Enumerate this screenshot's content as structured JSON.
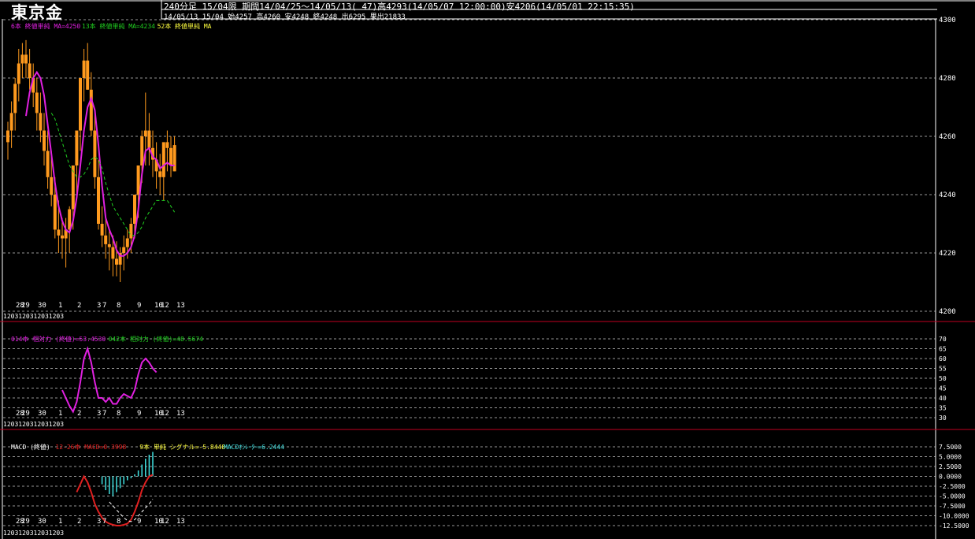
{
  "header": {
    "title": "東京金",
    "line1": "240分足 15/04限  期間14/04/25～14/05/13( 47)高4293(14/05/07 12:00:00)安4206(14/05/01 22:15:35)",
    "line2": "14/05/13 15/04 始4257 高4260 安4248 終4248 出6295 果出21833"
  },
  "colors": {
    "candle": "#ff9a1e",
    "ma6": "#e020e0",
    "ma13": "#20d020",
    "ma52": "#ffff40",
    "rsi14": "#e020e0",
    "macd": "#e02020",
    "signal": "#ffffff",
    "osc": "#40e0e0",
    "grid": "#c8c8c8",
    "separator": "#c00020"
  },
  "x_labels": [
    "28",
    "29",
    "30",
    "1",
    "2",
    "3",
    "7",
    "8",
    "9",
    "10",
    "12",
    "13"
  ],
  "x_dates_row": "12​0​3​12​0​3​12​0​3​12​0​3",
  "price_panel": {
    "legend": [
      {
        "text": "6本 終値単純 MA=4250",
        "color_key": "ma6"
      },
      {
        "text": "13本 終値単純 MA=4234",
        "color_key": "ma13"
      },
      {
        "text": "52本 終値単純 MA",
        "color_key": "ma52"
      }
    ],
    "y_ticks": [
      "4300",
      "4280",
      "4260",
      "4240",
      "4220",
      "4200"
    ]
  },
  "rsi_panel": {
    "legend": [
      {
        "text": "014本 相対力 (終値)=53.4530",
        "color_key": "rsi14"
      },
      {
        "text": "042本 相対力 (終値)=48.5674",
        "color_key": "ma13"
      }
    ],
    "y_ticks": [
      "70",
      "65",
      "60",
      "55",
      "50",
      "45",
      "40",
      "35",
      "30"
    ]
  },
  "macd_panel": {
    "legend": [
      {
        "text": "MACD (終値)",
        "color_key": "white"
      },
      {
        "text": "12-26本 MACD=0.3998",
        "color_key": "macd"
      },
      {
        "text": "9本 単純 シグナル=-5.8448",
        "color_key": "ma52"
      },
      {
        "text": "MACDｵｼﾚｰﾀｰ=6.2444",
        "color_key": "osc"
      }
    ],
    "y_ticks": [
      "7.5000",
      "5.0000",
      "2.5000",
      "0.0000",
      "-2.5000",
      "-5.0000",
      "-7.5000",
      "-10.0000",
      "-12.5000"
    ]
  },
  "chart_data": [
    {
      "type": "candlestick",
      "title": "東京金 240分足 15/04限",
      "x": [
        "28",
        "28",
        "28",
        "28",
        "28",
        "29",
        "29",
        "29",
        "29",
        "29",
        "30",
        "30",
        "30",
        "30",
        "30",
        "1",
        "1",
        "1",
        "1",
        "2",
        "2",
        "2",
        "2",
        "2",
        "3",
        "3",
        "3",
        "3",
        "3",
        "7",
        "7",
        "7",
        "7",
        "7",
        "8",
        "8",
        "8",
        "8",
        "9",
        "9",
        "9",
        "9",
        "10",
        "10",
        "12",
        "12",
        "13"
      ],
      "ylim": [
        4200,
        4300
      ],
      "open": [
        4258,
        4262,
        4268,
        4278,
        4285,
        4288,
        4285,
        4280,
        4275,
        4268,
        4262,
        4255,
        4246,
        4240,
        4228,
        4226,
        4225,
        4228,
        4235,
        4250,
        4262,
        4280,
        4286,
        4276,
        4262,
        4246,
        4230,
        4226,
        4223,
        4222,
        4218,
        4216,
        4220,
        4222,
        4225,
        4230,
        4240,
        4250,
        4260,
        4262,
        4256,
        4252,
        4248,
        4246,
        4258,
        4256,
        4257
      ],
      "high": [
        4265,
        4272,
        4280,
        4290,
        4292,
        4293,
        4290,
        4285,
        4280,
        4275,
        4268,
        4262,
        4255,
        4246,
        4238,
        4232,
        4232,
        4236,
        4245,
        4260,
        4275,
        4290,
        4292,
        4282,
        4268,
        4252,
        4236,
        4232,
        4228,
        4226,
        4224,
        4222,
        4226,
        4228,
        4232,
        4238,
        4250,
        4262,
        4275,
        4268,
        4262,
        4258,
        4254,
        4252,
        4262,
        4260,
        4260
      ],
      "low": [
        4252,
        4256,
        4262,
        4272,
        4280,
        4280,
        4276,
        4270,
        4262,
        4258,
        4250,
        4242,
        4236,
        4225,
        4220,
        4218,
        4215,
        4220,
        4228,
        4240,
        4255,
        4272,
        4276,
        4260,
        4242,
        4228,
        4222,
        4218,
        4214,
        4212,
        4212,
        4210,
        4214,
        4218,
        4220,
        4225,
        4232,
        4244,
        4250,
        4250,
        4246,
        4242,
        4240,
        4238,
        4248,
        4246,
        4248
      ],
      "close": [
        4262,
        4268,
        4278,
        4285,
        4288,
        4285,
        4280,
        4275,
        4268,
        4262,
        4255,
        4246,
        4240,
        4228,
        4226,
        4225,
        4228,
        4235,
        4250,
        4262,
        4280,
        4286,
        4276,
        4262,
        4246,
        4230,
        4226,
        4223,
        4222,
        4218,
        4216,
        4220,
        4222,
        4225,
        4230,
        4240,
        4250,
        4260,
        4262,
        4256,
        4252,
        4248,
        4246,
        4258,
        4256,
        4250,
        4248
      ],
      "series": [
        {
          "name": "6本 終値単純 MA",
          "values": [
            null,
            null,
            null,
            null,
            null,
            4267,
            4275,
            4280,
            4282,
            4280,
            4274,
            4264,
            4254,
            4244,
            4236,
            4231,
            4228,
            4227,
            4231,
            4239,
            4250,
            4262,
            4270,
            4273,
            4269,
            4257,
            4243,
            4232,
            4228,
            4225,
            4221,
            4219,
            4219,
            4220,
            4222,
            4226,
            4235,
            4247,
            4255,
            4256,
            4253,
            4252,
            4249,
            4250,
            4251,
            4250,
            4250
          ]
        },
        {
          "name": "13本 終値単純 MA",
          "values": [
            null,
            null,
            null,
            null,
            null,
            null,
            null,
            null,
            null,
            null,
            null,
            null,
            4268,
            4266,
            4262,
            4258,
            4254,
            4250,
            4248,
            4246,
            4246,
            4247,
            4249,
            4252,
            4253,
            4252,
            4249,
            4244,
            4240,
            4236,
            4234,
            4232,
            4230,
            4228,
            4226,
            4226,
            4227,
            4229,
            4232,
            4234,
            4236,
            4238,
            4238,
            4238,
            4238,
            4236,
            4234
          ]
        }
      ]
    },
    {
      "type": "line",
      "title": "相対力 (終値)",
      "ylim": [
        30,
        70
      ],
      "series": [
        {
          "name": "014本 相対力 (終値)",
          "values": [
            null,
            null,
            null,
            null,
            null,
            null,
            null,
            null,
            null,
            null,
            null,
            null,
            null,
            null,
            null,
            44,
            40,
            36,
            33,
            38,
            48,
            60,
            65,
            58,
            48,
            40,
            40,
            38,
            40,
            37,
            37,
            40,
            42,
            41,
            40,
            44,
            52,
            58,
            60,
            58,
            55,
            53
          ]
        }
      ]
    },
    {
      "type": "line",
      "title": "MACD (終値)",
      "ylim": [
        -12.5,
        7.5
      ],
      "series": [
        {
          "name": "12-26本 MACD",
          "values": [
            null,
            null,
            null,
            null,
            null,
            null,
            null,
            null,
            null,
            null,
            null,
            null,
            null,
            null,
            null,
            null,
            null,
            null,
            null,
            -4.0,
            -2.0,
            0.0,
            -1.5,
            -4.0,
            -7.0,
            -9.0,
            -10.5,
            -11.5,
            -12.0,
            -12.3,
            -12.5,
            -12.5,
            -12.3,
            -12.0,
            -11.0,
            -9.0,
            -6.5,
            -3.5,
            -1.5,
            0.0,
            0.4
          ]
        },
        {
          "name": "9本 単純 シグナル",
          "values": [
            null,
            null,
            null,
            null,
            null,
            null,
            null,
            null,
            null,
            null,
            null,
            null,
            null,
            null,
            null,
            null,
            null,
            null,
            null,
            null,
            null,
            null,
            null,
            null,
            null,
            null,
            null,
            null,
            -6.5,
            -7.5,
            -8.5,
            -9.5,
            -10.5,
            -11.2,
            -11.5,
            -11.0,
            -10.0,
            -9.0,
            -8.0,
            -7.0,
            -5.8
          ]
        },
        {
          "name": "MACDｵｼﾚｰﾀｰ",
          "values": [
            null,
            null,
            null,
            null,
            null,
            null,
            null,
            null,
            null,
            null,
            null,
            null,
            null,
            null,
            null,
            null,
            null,
            null,
            null,
            null,
            null,
            null,
            null,
            null,
            null,
            null,
            -2.0,
            -3.5,
            -4.5,
            -5.0,
            -4.0,
            -3.0,
            -2.0,
            -1.0,
            -0.5,
            0.5,
            1.5,
            3.0,
            4.5,
            5.5,
            6.2
          ]
        }
      ]
    }
  ]
}
